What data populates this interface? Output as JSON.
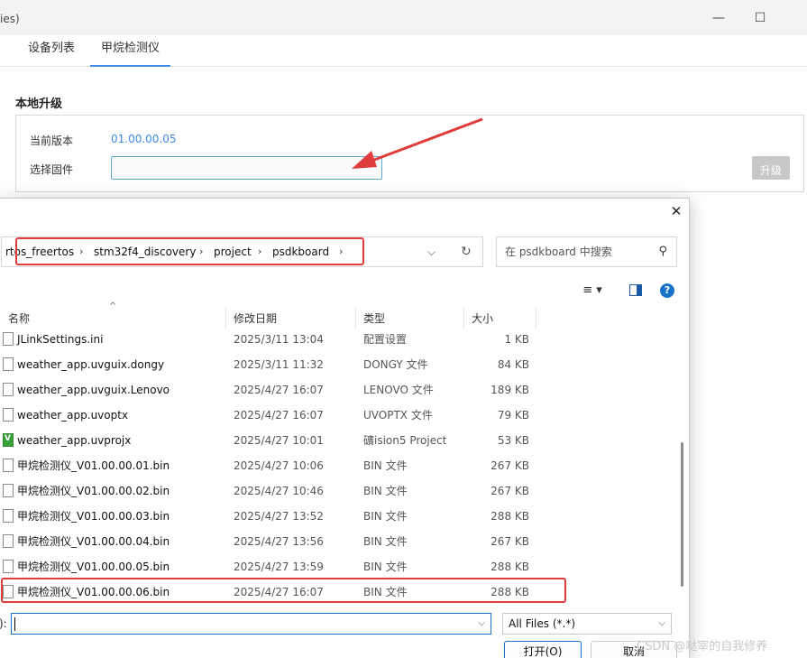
{
  "app": {
    "title_fragment": "ies)",
    "window_controls": {
      "minimize": "—",
      "maximize": "☐",
      "close": "✕"
    },
    "tabs": [
      {
        "label": "设备列表"
      },
      {
        "label": "甲烷检测仪"
      }
    ],
    "section_title": "本地升级",
    "current_version_label": "当前版本",
    "current_version_value": "01.00.00.05",
    "select_firmware_label": "选择固件",
    "firmware_input_value": "",
    "upgrade_button": "升级",
    "accent_color": "#3d8be8"
  },
  "dialog": {
    "close": "✕",
    "breadcrumb": [
      "rtos_freertos",
      "stm32f4_discovery",
      "project",
      "psdkboard"
    ],
    "breadcrumb_separator": "›",
    "address_dropdown": "⌵",
    "refresh": "↻",
    "search_placeholder": "在 psdkboard 中搜索",
    "search_icon": "⚲",
    "view_menu_icon": "≡ ▾",
    "help_icon": "?",
    "columns": {
      "name": "名称",
      "date": "修改日期",
      "type": "类型",
      "size": "大小"
    },
    "sort_caret": "^",
    "files": [
      {
        "name": "JLinkSettings.ini",
        "date": "2025/3/11 13:04",
        "type": "配置设置",
        "size": "1 KB",
        "icon": "file-icon"
      },
      {
        "name": "weather_app.uvguix.dongy",
        "date": "2025/3/11 11:32",
        "type": "DONGY 文件",
        "size": "84 KB",
        "icon": "file-icon"
      },
      {
        "name": "weather_app.uvguix.Lenovo",
        "date": "2025/4/27 16:07",
        "type": "LENOVO 文件",
        "size": "189 KB",
        "icon": "file-icon"
      },
      {
        "name": "weather_app.uvoptx",
        "date": "2025/4/27 16:07",
        "type": "UVOPTX 文件",
        "size": "79 KB",
        "icon": "file-icon"
      },
      {
        "name": "weather_app.uvprojx",
        "date": "2025/4/27 10:01",
        "type": "礦ision5 Project",
        "size": "53 KB",
        "icon": "keil-project-icon"
      },
      {
        "name": "甲烷检测仪_V01.00.00.01.bin",
        "date": "2025/4/27 10:06",
        "type": "BIN 文件",
        "size": "267 KB",
        "icon": "file-icon"
      },
      {
        "name": "甲烷检测仪_V01.00.00.02.bin",
        "date": "2025/4/27 10:46",
        "type": "BIN 文件",
        "size": "267 KB",
        "icon": "file-icon"
      },
      {
        "name": "甲烷检测仪_V01.00.00.03.bin",
        "date": "2025/4/27 13:52",
        "type": "BIN 文件",
        "size": "288 KB",
        "icon": "file-icon"
      },
      {
        "name": "甲烷检测仪_V01.00.00.04.bin",
        "date": "2025/4/27 13:56",
        "type": "BIN 文件",
        "size": "267 KB",
        "icon": "file-icon"
      },
      {
        "name": "甲烷检测仪_V01.00.00.05.bin",
        "date": "2025/4/27 13:59",
        "type": "BIN 文件",
        "size": "288 KB",
        "icon": "file-icon"
      },
      {
        "name": "甲烷检测仪_V01.00.00.06.bin",
        "date": "2025/4/27 16:07",
        "type": "BIN 文件",
        "size": "288 KB",
        "icon": "file-icon"
      }
    ],
    "filename_label": "):",
    "filename_value": "",
    "filetype_value": "All Files (*.*)",
    "open_button": "打开(O)",
    "cancel_button": "取消",
    "highlight_color": "#e03c3c"
  },
  "watermark": "CSDN @哒宰的自我修养"
}
